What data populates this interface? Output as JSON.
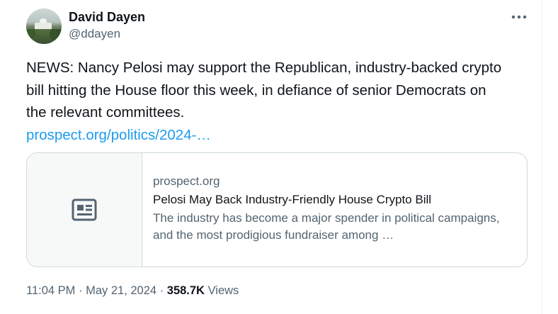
{
  "author": {
    "name": "David Dayen",
    "handle": "@ddayen",
    "avatar_icon": "avatar-photo"
  },
  "more_icon": "more-horizontal-icon",
  "tweet": {
    "text": "NEWS: Nancy Pelosi may support the Republican, industry-backed crypto bill hitting the House floor this week, in defiance of senior Democrats on the relevant committees.",
    "link": "prospect.org/politics/2024-…"
  },
  "card": {
    "thumb_icon": "article-icon",
    "domain": "prospect.org",
    "title": "Pelosi May Back Industry-Friendly House Crypto Bill",
    "description": "The industry has become a major spender in political campaigns, and the most prodigious fundraiser among …"
  },
  "meta": {
    "time": "11:04 PM",
    "separator": "·",
    "date": "May 21, 2024",
    "views_count": "358.7K",
    "views_label": "Views"
  },
  "colors": {
    "link": "#1d9bf0",
    "secondary_text": "#536471",
    "primary_text": "#0f1419",
    "border": "#cfd9de"
  }
}
